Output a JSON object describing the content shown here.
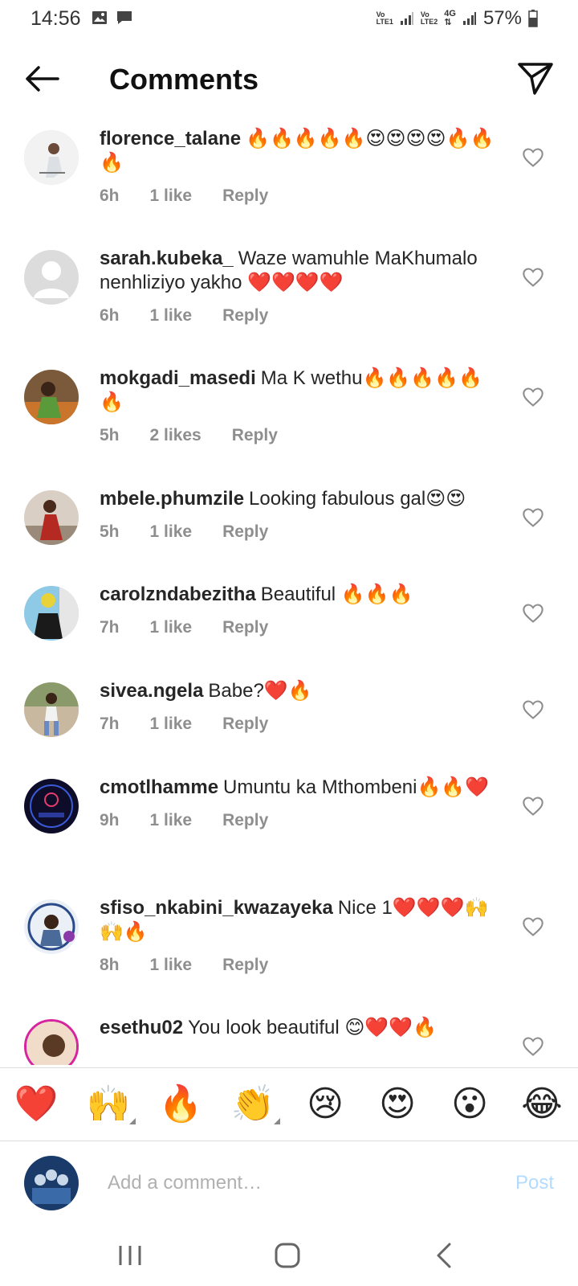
{
  "status_bar": {
    "time": "14:56",
    "lte1_top": "Vo",
    "lte1_bottom": "LTE1",
    "lte2_top": "Vo",
    "lte2_bottom": "LTE2",
    "network": "4G",
    "battery": "57%"
  },
  "header": {
    "title": "Comments"
  },
  "comments": [
    {
      "username": "florence_talane",
      "text": "🔥🔥🔥🔥🔥😍😍😍😍🔥🔥🔥",
      "time": "6h",
      "likes": "1 like",
      "reply": "Reply"
    },
    {
      "username": "sarah.kubeka_",
      "text": "Waze wamuhle MaKhumalo nenhliziyo yakho ❤️❤️❤️❤️",
      "time": "6h",
      "likes": "1 like",
      "reply": "Reply"
    },
    {
      "username": "mokgadi_masedi",
      "text": "Ma K wethu🔥🔥🔥🔥🔥🔥",
      "time": "5h",
      "likes": "2 likes",
      "reply": "Reply"
    },
    {
      "username": "mbele.phumzile",
      "text": "Looking fabulous gal😍😍",
      "time": "5h",
      "likes": "1 like",
      "reply": "Reply"
    },
    {
      "username": "carolzndabezitha",
      "text": "Beautiful 🔥🔥🔥",
      "time": "7h",
      "likes": "1 like",
      "reply": "Reply"
    },
    {
      "username": "sivea.ngela",
      "text": "Babe?❤️🔥",
      "time": "7h",
      "likes": "1 like",
      "reply": "Reply"
    },
    {
      "username": "cmotlhamme",
      "text": "Umuntu ka Mthombeni🔥🔥❤️",
      "time": "9h",
      "likes": "1 like",
      "reply": "Reply"
    },
    {
      "username": "sfiso_nkabini_kwazayeka",
      "text": "Nice 1❤️❤️❤️🙌🙌🔥",
      "time": "8h",
      "likes": "1 like",
      "reply": "Reply"
    },
    {
      "username": "esethu02",
      "text": "You look beautiful 😊❤️❤️🔥",
      "time": "",
      "likes": "",
      "reply": ""
    }
  ],
  "emoji_bar": [
    "❤️",
    "🙌",
    "🔥",
    "👏",
    "😢",
    "😍",
    "😮",
    "😂"
  ],
  "composer": {
    "placeholder": "Add a comment…",
    "post_label": "Post"
  },
  "colors": {
    "text": "#262626",
    "meta": "#8e8e8e",
    "post_disabled": "#b3dbff",
    "divider": "#dbdbdb"
  }
}
